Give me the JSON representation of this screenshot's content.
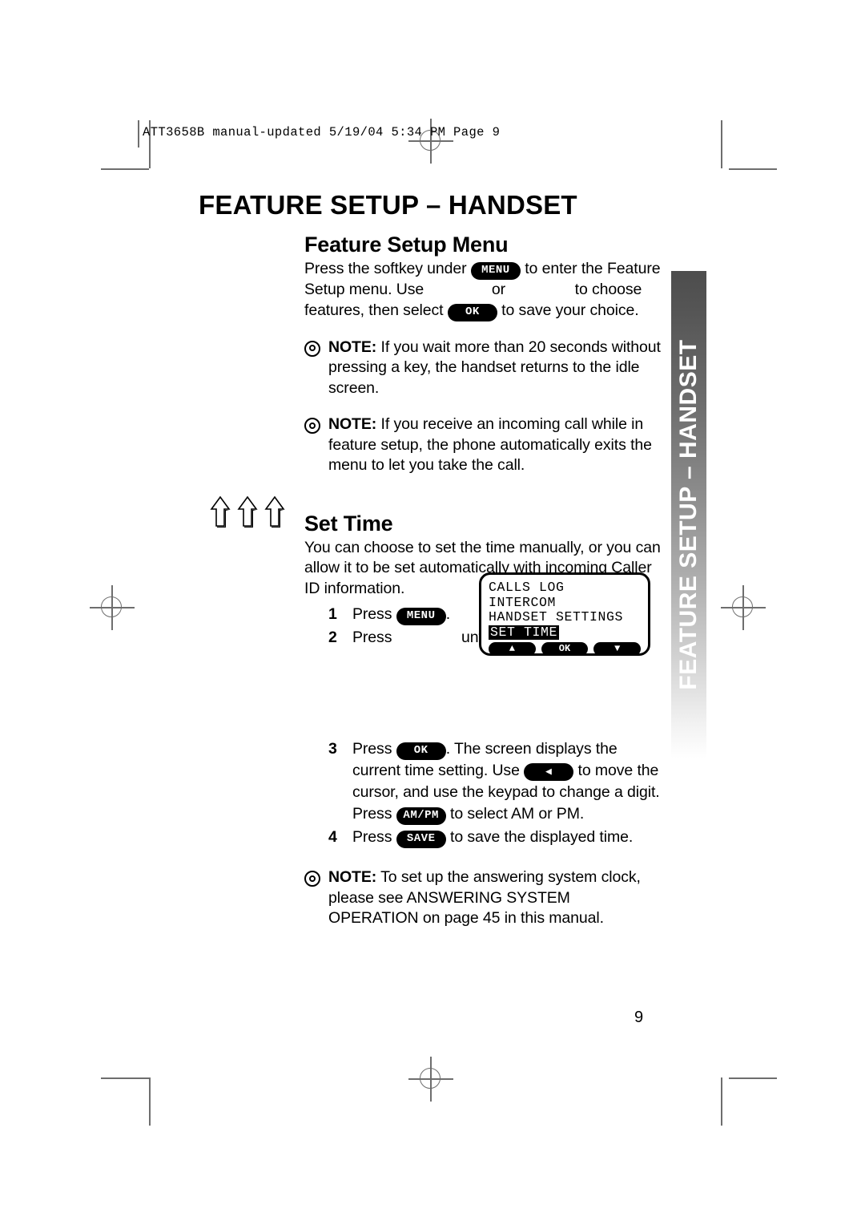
{
  "file_header": {
    "text": "ATT3658B manual-updated  5/19/04  5:34 PM  Page 9"
  },
  "side_tab": {
    "label": "FEATURE SETUP – HANDSET",
    "gradient_top": "#4d4d4d",
    "gradient_bottom": "#ffffff",
    "text_color": "#ffffff"
  },
  "page_title": "FEATURE SETUP – HANDSET",
  "sections": {
    "feature_setup_menu": {
      "heading": "Feature Setup Menu",
      "line_1_pre": "Press the softkey under",
      "button_menu": "MENU",
      "line_1_post": "to enter the Feature",
      "line_2_pre": "Setup menu.  Use",
      "line_2_mid": "or",
      "line_2_post": "to choose",
      "line_3_pre": "features, then select",
      "button_ok": "OK",
      "line_3_post": "to save your choice."
    },
    "set_time": {
      "heading": "Set Time",
      "intro": "You can choose to set the time manually, or you can allow it to be set automatically with incoming Caller ID information.",
      "steps": [
        {
          "num": "1",
          "pre": "Press",
          "button": "MENU",
          "post": "."
        },
        {
          "num": "2",
          "pre": "Press",
          "post": "until the screen displays"
        },
        {
          "num": "3",
          "pre": "Press",
          "button": "OK",
          "post": ". The screen displays the current time setting.  Use",
          "button_2": "◀",
          "post_2": "to move the cursor, and use the keypad to change a digit.",
          "press_3": "Press",
          "button_3": "AM/PM",
          "post_3": "to select AM or PM."
        },
        {
          "num": "4",
          "pre": "Press",
          "button": "SAVE",
          "post": "to save the displayed time."
        }
      ]
    }
  },
  "notes": [
    {
      "label": "NOTE:",
      "text": "If you wait more than 20 seconds without pressing a key, the handset returns to the idle screen."
    },
    {
      "label": "NOTE:",
      "text": "If you receive an incoming call while in feature setup, the phone automatically exits the menu to let you take the call."
    },
    {
      "label": "NOTE:",
      "text": "To set up the answering system clock, please see ANSWERING SYSTEM OPERATION on page 45 in this manual."
    }
  ],
  "lcd_screen": {
    "lines": [
      "CALLS LOG",
      "INTERCOM",
      "HANDSET SETTINGS"
    ],
    "selected_line": "SET TIME",
    "softkeys": [
      "▲",
      "OK",
      "▼"
    ]
  },
  "page_number": "9"
}
